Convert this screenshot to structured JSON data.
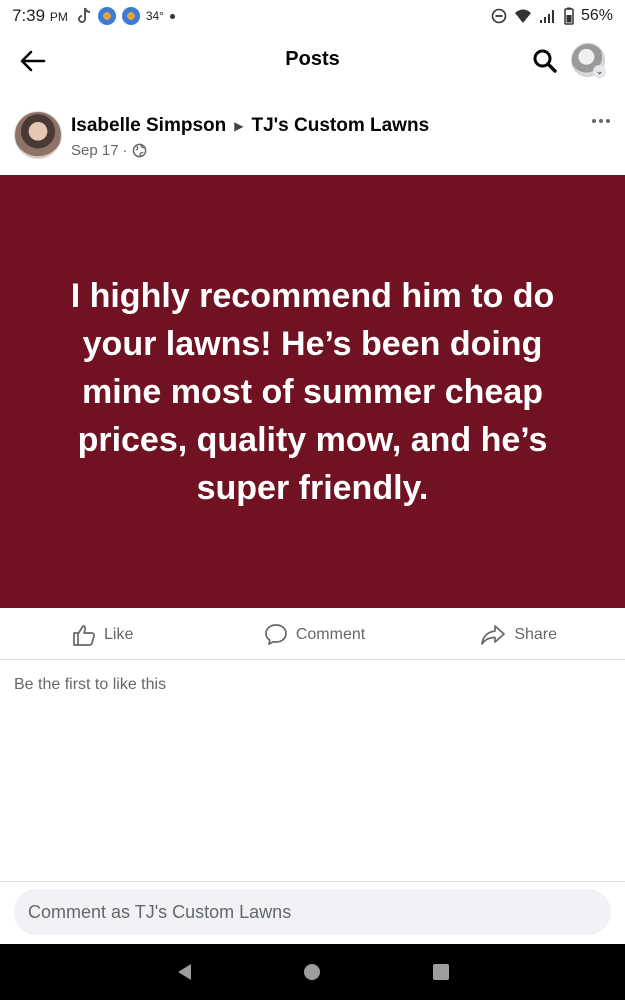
{
  "status_bar": {
    "time": "7:39",
    "ampm": "PM",
    "temperature": "34°",
    "battery": "56%"
  },
  "header": {
    "title": "Posts"
  },
  "post": {
    "author": "Isabelle Simpson",
    "page": "TJ's Custom Lawns",
    "date": "Sep 17",
    "separator": "·",
    "audience_icon": "globe-icon",
    "body_text": "I highly recommend him to do your lawns! He’s been doing mine most of summer cheap prices, quality mow, and he’s super friendly.",
    "background_color": "#711223"
  },
  "actions": {
    "like_label": "Like",
    "comment_label": "Comment",
    "share_label": "Share"
  },
  "reactions": {
    "summary": "Be the first to like this"
  },
  "composer": {
    "placeholder": "Comment as TJ's Custom Lawns"
  },
  "colors": {
    "accent": "#711223",
    "muted_text": "#65676b",
    "input_bg": "#f0f2f5"
  }
}
